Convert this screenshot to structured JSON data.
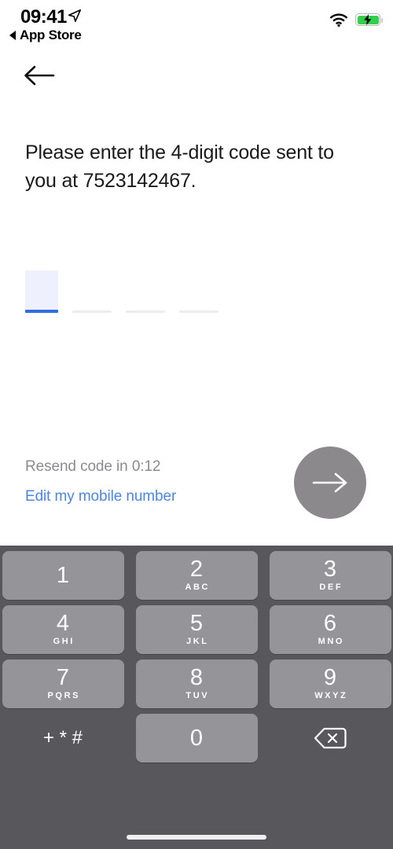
{
  "status_bar": {
    "time": "09:41",
    "location_icon": "location-arrow-icon",
    "back_label": "App Store",
    "back_triangle_icon": "triangle-left-icon",
    "wifi_icon": "wifi-icon",
    "battery_icon": "battery-charging-icon",
    "battery_color": "#32d04a"
  },
  "nav": {
    "back_icon": "arrow-left-icon"
  },
  "content": {
    "prompt": "Please enter the 4-digit code sent to you at 7523142467.",
    "phone_number": "7523142467",
    "code_digits": 4,
    "code_fields": [
      {
        "value": "",
        "active": true
      },
      {
        "value": "",
        "active": false
      },
      {
        "value": "",
        "active": false
      },
      {
        "value": "",
        "active": false
      }
    ],
    "active_underline_color": "#2f6ede",
    "inactive_underline_color": "#ececf0",
    "active_field_fill": "#eef1fd",
    "resend_text": "Resend code in 0:12",
    "resend_timer": "0:12",
    "edit_link": "Edit my mobile number",
    "edit_link_color": "#4a86e8",
    "submit": {
      "icon": "arrow-right-icon",
      "background": "#8b898c"
    }
  },
  "keyboard": {
    "background": "#58575b",
    "key_color": "#959499",
    "rows": [
      [
        {
          "digit": "1",
          "letters": "",
          "type": "key"
        },
        {
          "digit": "2",
          "letters": "ABC",
          "type": "key"
        },
        {
          "digit": "3",
          "letters": "DEF",
          "type": "key"
        }
      ],
      [
        {
          "digit": "4",
          "letters": "GHI",
          "type": "key"
        },
        {
          "digit": "5",
          "letters": "JKL",
          "type": "key"
        },
        {
          "digit": "6",
          "letters": "MNO",
          "type": "key"
        }
      ],
      [
        {
          "digit": "7",
          "letters": "PQRS",
          "type": "key"
        },
        {
          "digit": "8",
          "letters": "TUV",
          "type": "key"
        },
        {
          "digit": "9",
          "letters": "WXYZ",
          "type": "key"
        }
      ],
      [
        {
          "digit": "+ * #",
          "letters": "",
          "type": "symbols"
        },
        {
          "digit": "0",
          "letters": "",
          "type": "key"
        },
        {
          "digit": "",
          "letters": "",
          "type": "delete",
          "icon": "backspace-icon"
        }
      ]
    ]
  },
  "home_indicator": "home-indicator"
}
